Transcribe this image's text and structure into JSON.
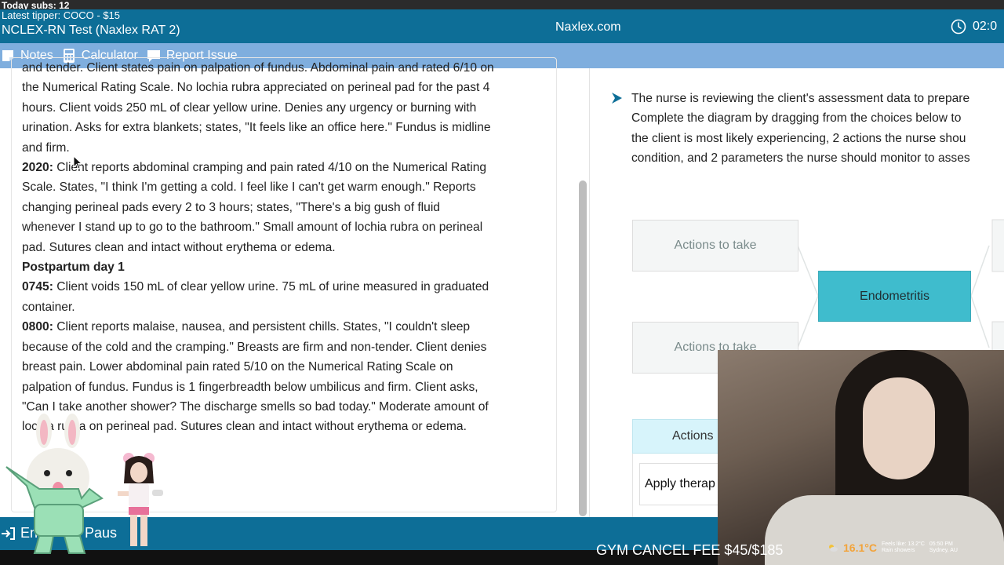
{
  "stream_overlay": {
    "subs": "Today subs: 12",
    "tipper": "Latest tipper: COCO - $15",
    "cancel_fee": "GYM CANCEL FEE $45/$185",
    "weather_temp": "16.1°C",
    "weather_feels": "Feels like: 13.2°C",
    "weather_desc": "Rain showers",
    "weather_time": "05:50 PM",
    "weather_location": "Sydney, AU"
  },
  "header": {
    "exam_title": "NCLEX-RN Test (Naxlex RAT 2)",
    "site": "Naxlex.com",
    "timer": "02:0"
  },
  "toolbar": {
    "notes": "Notes",
    "calculator": "Calculator",
    "report": "Report Issue"
  },
  "notes": {
    "line0": "and tender. Client states pain on palpation of fundus. Abdominal pain and rated 6/10 on",
    "line1": "the Numerical Rating Scale. No lochia rubra appreciated on perineal pad for the past 4",
    "line2": "hours. Client voids 250 mL of clear yellow urine. Denies any urgency or burning with",
    "line3": "urination. Asks for extra blankets; states, \"It feels like an office here.\" Fundus is midline",
    "line4": "and firm.",
    "e2020_time": "2020:",
    "e2020_l1": " Client reports abdominal cramping and pain rated 4/10 on the Numerical Rating",
    "e2020_l2": "Scale. States, \"I think I'm getting a cold. I feel like I can't get warm enough.\" Reports",
    "e2020_l3": "changing perineal pads every 2 to 3 hours; states, \"There's a big gush of fluid",
    "e2020_l4": "whenever I stand up to go to the bathroom.\" Small amount of lochia rubra on perineal",
    "e2020_l5": "pad. Sutures clean and intact without erythema or edema.",
    "pp_day": "Postpartum day 1",
    "e0745_time": "0745:",
    "e0745_l1": " Client voids 150 mL of clear yellow urine. 75 mL of urine measured in graduated",
    "e0745_l2": "container.",
    "e0800_time": "0800:",
    "e0800_l1": " Client reports malaise, nausea, and persistent chills. States, \"I couldn't sleep",
    "e0800_l2": "because of the cold and the cramping.\" Breasts are firm and non-tender. Client denies",
    "e0800_l3": "breast pain. Lower abdominal pain rated 5/10 on the Numerical Rating Scale on",
    "e0800_l4": "palpation of fundus. Fundus is 1 fingerbreadth below umbilicus and firm. Client asks,",
    "e0800_l5": "\"Can I take another shower? The discharge smells so bad today.\" Moderate amount of",
    "e0800_l6": "lochia rubra on perineal pad. Sutures clean and intact without erythema or edema."
  },
  "question": {
    "line1": "The nurse is reviewing the client's assessment data to prepare",
    "line2": "Complete the diagram by dragging from the choices below to",
    "line3": "the client is most likely experiencing, 2 actions the nurse shou",
    "line4": "condition, and 2 parameters the nurse should monitor to asses"
  },
  "diagram": {
    "slot1": "Actions to take",
    "slot2": "Actions to take",
    "condition": "Endometritis"
  },
  "choices": {
    "header": "Actions",
    "item1": "Apply therap"
  },
  "footer": {
    "end": "En",
    "pause": "Paus"
  }
}
